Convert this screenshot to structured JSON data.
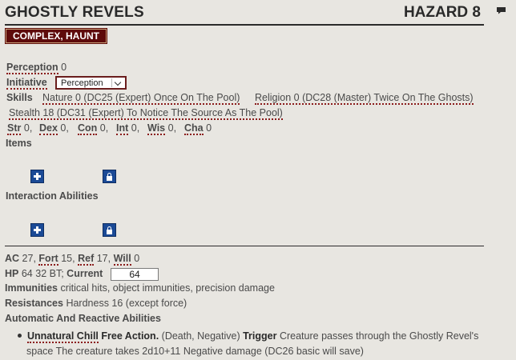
{
  "header": {
    "title": "GHOSTLY REVELS",
    "level": "HAZARD 8",
    "chat_icon": "chat-icon"
  },
  "tag": "COMPLEX, HAUNT",
  "perception": {
    "label": "Perception",
    "value": "0"
  },
  "initiative": {
    "label": "Initiative",
    "selected": "Perception"
  },
  "skills": {
    "label": "Skills",
    "items": [
      "Nature 0 (DC25 (Expert) Once On The Pool)",
      "Religion 0 (DC28 (Master) Twice On The Ghosts)",
      "Stealth 18 (DC31 (Expert) To Notice The Source As The Pool)"
    ]
  },
  "abilities": [
    {
      "label": "Str",
      "value": "0"
    },
    {
      "label": "Dex",
      "value": "0"
    },
    {
      "label": "Con",
      "value": "0"
    },
    {
      "label": "Int",
      "value": "0"
    },
    {
      "label": "Wis",
      "value": "0"
    },
    {
      "label": "Cha",
      "value": "0"
    }
  ],
  "items_heading": "Items",
  "interaction_heading": "Interaction Abilities",
  "defense": {
    "ac_label": "AC",
    "ac": "27",
    "fort_label": "Fort",
    "fort": "15",
    "ref_label": "Ref",
    "ref": "17",
    "will_label": "Will",
    "will": "0",
    "hp_label": "HP",
    "hp": "64",
    "bt": "32 BT;",
    "current_label": "Current",
    "current": "64"
  },
  "immunities": {
    "label": "Immunities",
    "text": "critical hits, object immunities, precision damage"
  },
  "resistances": {
    "label": "Resistances",
    "text": "Hardness 16 (except force)"
  },
  "reactive_heading": "Automatic And Reactive Abilities",
  "reaction": {
    "name": "Unnatural Chill",
    "action": "Free Action.",
    "traits": "(Death, Negative)",
    "trigger_label": "Trigger",
    "trigger_text": "Creature passes through the Ghostly Revel's",
    "line2": "space The creature takes 2d10+11 Negative damage (DC26 basic will save)"
  }
}
